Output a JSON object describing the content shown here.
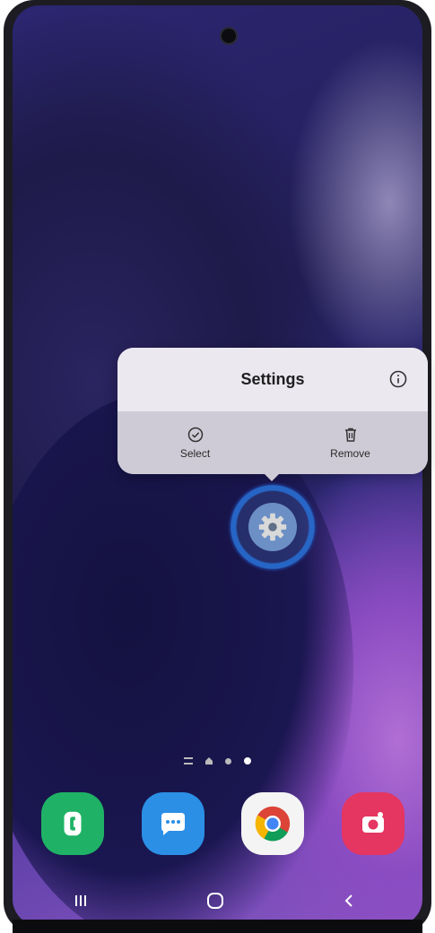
{
  "popup": {
    "title": "Settings",
    "actions": [
      {
        "label": "Select",
        "icon": "check-circle-icon"
      },
      {
        "label": "Remove",
        "icon": "trash-icon"
      }
    ],
    "info_icon": "info-icon"
  },
  "selected_app": {
    "name": "Settings",
    "icon": "gear-icon"
  },
  "page_indicator": {
    "pages": 3,
    "active_page": 3
  },
  "dock": [
    {
      "name": "Phone",
      "icon": "phone-icon",
      "color": "#1fb266"
    },
    {
      "name": "Messages",
      "icon": "messages-icon",
      "color": "#2b8fe6"
    },
    {
      "name": "Chrome",
      "icon": "chrome-icon",
      "color": "#f4f4f4"
    },
    {
      "name": "Camera",
      "icon": "camera-icon",
      "color": "#e53561"
    }
  ],
  "nav": [
    "recents-icon",
    "home-icon",
    "back-icon"
  ]
}
